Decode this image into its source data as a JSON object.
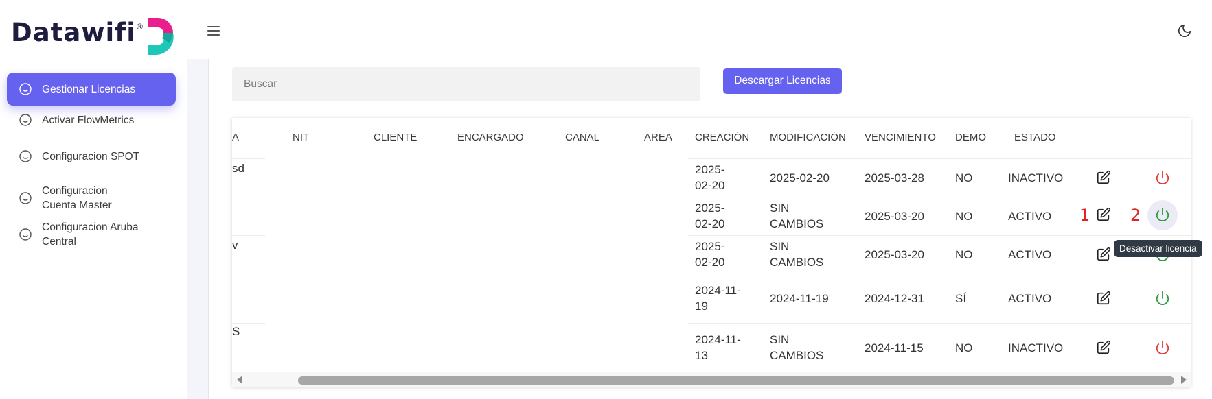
{
  "brand": {
    "name": "Datawifi",
    "registered": "®",
    "colors": {
      "pink": "#e91e8c",
      "teal": "#1ec8b8",
      "dark": "#1f1d3d"
    }
  },
  "header": {
    "menu_icon": "hamburger-icon",
    "theme_icon": "moon-icon"
  },
  "sidebar": {
    "items": [
      {
        "label": "Gestionar Licencias",
        "active": true
      },
      {
        "label": "Activar FlowMetrics",
        "active": false
      },
      {
        "label": "Configuracion SPOT",
        "active": false
      },
      {
        "label": "Configuracion Cuenta Master",
        "active": false
      },
      {
        "label": "Configuracion Aruba Central",
        "active": false
      }
    ],
    "accent": "#6462ee"
  },
  "search": {
    "placeholder": "Buscar",
    "value": ""
  },
  "toolbar": {
    "download_label": "Descargar Licencias"
  },
  "table": {
    "headers": [
      "A",
      "NIT",
      "CLIENTE",
      "ENCARGADO",
      "CANAL",
      "AREA",
      "CREACIÓN",
      "MODIFICACIÓN",
      "VENCIMIENTO",
      "DEMO",
      "ESTADO"
    ],
    "rows": [
      {
        "fragment": "sd",
        "creacion": "2025-\n02-20",
        "modificacion": "2025-02-20",
        "vencimiento": "2025-03-28",
        "demo": "NO",
        "estado": "INACTIVO",
        "power_state": "inactive"
      },
      {
        "fragment": "",
        "creacion": "2025-\n02-20",
        "modificacion": "SIN\nCAMBIOS",
        "vencimiento": "2025-03-20",
        "demo": "NO",
        "estado": "ACTIVO",
        "power_state": "active"
      },
      {
        "fragment": "v",
        "creacion": "2025-\n02-20",
        "modificacion": "SIN\nCAMBIOS",
        "vencimiento": "2025-03-20",
        "demo": "NO",
        "estado": "ACTIVO",
        "power_state": "active"
      },
      {
        "fragment": "",
        "creacion": "2024-11-\n19",
        "modificacion": "2024-11-19",
        "vencimiento": "2024-12-31",
        "demo": "SÍ",
        "estado": "ACTIVO",
        "power_state": "active"
      },
      {
        "fragment": "S",
        "creacion": "2024-11-\n13",
        "modificacion": "SIN\nCAMBIOS",
        "vencimiento": "2024-11-15",
        "demo": "NO",
        "estado": "INACTIVO",
        "power_state": "inactive"
      }
    ],
    "status_colors": {
      "active": "#2e9b3e",
      "inactive": "#e23b3b"
    }
  },
  "annotations": {
    "mark_1": "1",
    "mark_2": "2"
  },
  "tooltip": {
    "text": "Desactivar licencia"
  }
}
